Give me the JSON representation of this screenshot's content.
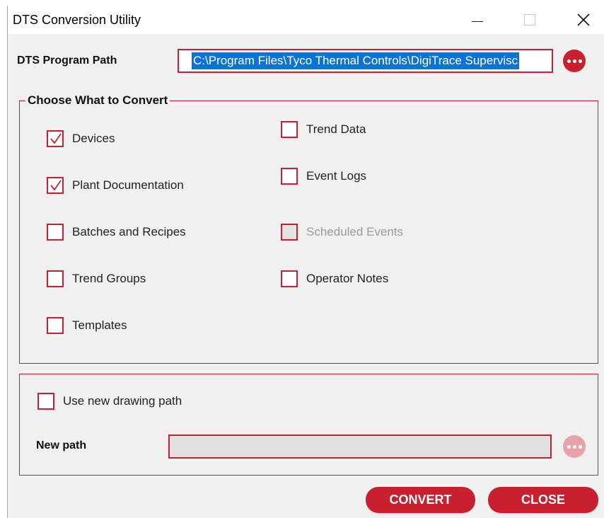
{
  "window": {
    "title": "DTS Conversion Utility"
  },
  "program_path": {
    "label": "DTS Program Path",
    "value": "C:\\Program Files\\Tyco Thermal Controls\\DigiTrace Supervisc",
    "browse_icon": "ellipsis-icon"
  },
  "convert_group": {
    "title": "Choose What to Convert",
    "left_items": [
      {
        "label": "Devices",
        "checked": true,
        "enabled": true
      },
      {
        "label": "Plant Documentation",
        "checked": true,
        "enabled": true
      },
      {
        "label": "Batches and Recipes",
        "checked": false,
        "enabled": true
      },
      {
        "label": "Trend Groups",
        "checked": false,
        "enabled": true
      },
      {
        "label": "Templates",
        "checked": false,
        "enabled": true
      }
    ],
    "right_items": [
      {
        "label": "Trend Data",
        "checked": false,
        "enabled": true
      },
      {
        "label": "Event Logs",
        "checked": false,
        "enabled": true
      },
      {
        "label": "Scheduled Events",
        "checked": false,
        "enabled": false
      },
      {
        "label": "Operator Notes",
        "checked": false,
        "enabled": true
      }
    ]
  },
  "drawing_group": {
    "use_new_path_label": "Use new drawing path",
    "use_new_path_checked": false,
    "new_path_label": "New path",
    "new_path_value": ""
  },
  "buttons": {
    "convert": "CONVERT",
    "close": "CLOSE"
  },
  "colors": {
    "accent": "#c8202e",
    "selection": "#0a74d6",
    "window_bg": "#f0f0f0"
  }
}
